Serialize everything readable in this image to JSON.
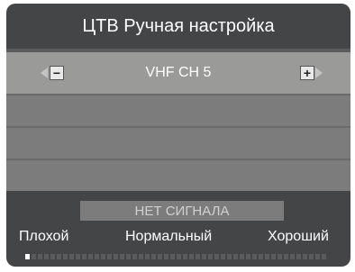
{
  "menu": {
    "title": "ЦТВ Ручная настройка",
    "channel_value": "VHF CH 5",
    "minus_symbol": "−",
    "plus_symbol": "+",
    "status_text": "НЕТ СИГНАЛА"
  },
  "signal": {
    "label_bad": "Плохой",
    "label_normal": "Нормальный",
    "label_good": "Хороший",
    "segments_total": 48,
    "segments_filled": 1,
    "level_fraction": 0.02
  },
  "colors": {
    "panel_bg": "#444546",
    "selected_row": "#9a9a98",
    "empty_row": "#7c7c7c",
    "text": "#ffffff",
    "status_text": "#d0d0d0"
  }
}
